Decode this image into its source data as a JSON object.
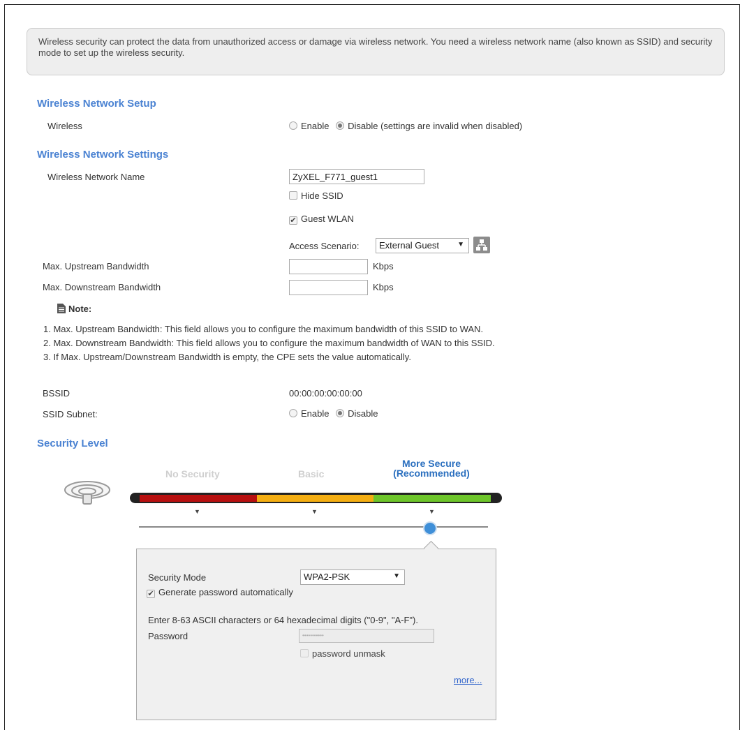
{
  "intro_text": "Wireless security can protect the data from unauthorized access or damage via wireless network. You need a wireless network name (also known as SSID) and security mode to set up the wireless security.",
  "setup": {
    "heading": "Wireless Network Setup",
    "wireless_label": "Wireless",
    "enable_label": "Enable",
    "disable_label": "Disable (settings are invalid when disabled)",
    "selected": "Disable"
  },
  "settings": {
    "heading": "Wireless Network Settings",
    "network_name_label": "Wireless Network Name",
    "network_name_value": "ZyXEL_F771_guest1",
    "hide_ssid_label": "Hide SSID",
    "hide_ssid_checked": false,
    "guest_wlan_label": "Guest WLAN",
    "guest_wlan_checked": true,
    "access_scenario_label": "Access Scenario:",
    "access_scenario_value": "External Guest",
    "up_label": "Max. Upstream Bandwidth",
    "down_label": "Max. Downstream Bandwidth",
    "up_value": "",
    "down_value": "",
    "unit": "Kbps"
  },
  "note": {
    "title": "Note:",
    "items": [
      "1. Max. Upstream Bandwidth: This field allows you to configure the maximum bandwidth of this SSID to WAN.",
      "2. Max. Downstream Bandwidth: This field allows you to configure the maximum bandwidth of WAN to this SSID.",
      "3. If Max. Upstream/Downstream Bandwidth is empty, the CPE sets the value automatically."
    ]
  },
  "bssid": {
    "label": "BSSID",
    "value": "00:00:00:00:00:00"
  },
  "ssid_subnet": {
    "label": "SSID Subnet:",
    "enable_label": "Enable",
    "disable_label": "Disable",
    "selected": "Disable"
  },
  "security": {
    "heading": "Security Level",
    "levels": [
      "No Security",
      "Basic",
      "More Secure\n(Recommended)"
    ],
    "level_more_line1": "More Secure",
    "level_more_line2": "(Recommended)",
    "selected_level": "More Secure",
    "colors": {
      "red": "#b80f0f",
      "orange": "#f4ae12",
      "green": "#6dc52a",
      "accent": "#4a82d2"
    },
    "mode_label": "Security Mode",
    "mode_value": "WPA2-PSK",
    "gen_pw_label": "Generate password automatically",
    "gen_pw_checked": true,
    "hint": "Enter 8-63 ASCII characters or 64 hexadecimal digits (\"0-9\", \"A-F\").",
    "password_label": "Password",
    "password_value": "•••••••••••",
    "unmask_label": "password unmask",
    "more_link": "more..."
  }
}
